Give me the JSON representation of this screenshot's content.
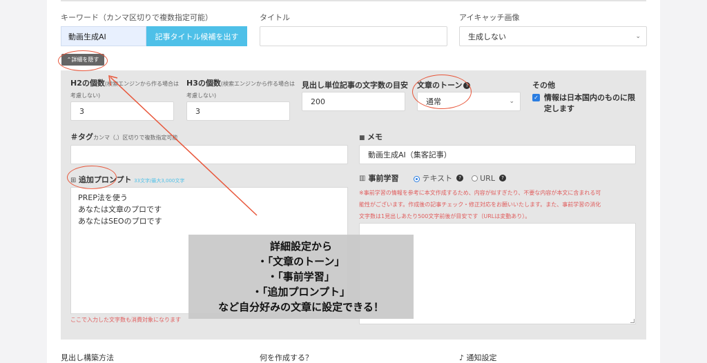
{
  "keyword": {
    "label": "キーワード（カンマ区切りで複数指定可能）",
    "value": "動画生成AI",
    "button": "記事タイトル候補を出す"
  },
  "title_field": {
    "label": "タイトル",
    "value": ""
  },
  "eyecatch": {
    "label": "アイキャッチ画像",
    "value": "生成しない"
  },
  "hide_button": "⌃詳細を隠す",
  "h2": {
    "label": "H2の個数",
    "note": "(検索エンジンから作る場合は考慮しない)",
    "value": "3"
  },
  "h3": {
    "label": "H3の個数",
    "note": "(検索エンジンから作る場合は考慮しない)",
    "value": "3"
  },
  "chars": {
    "label": "見出し単位記事の文字数の目安",
    "value": "200"
  },
  "tone": {
    "label": "文章のトーン",
    "value": "通常"
  },
  "other": {
    "label": "その他",
    "check_label": "情報は日本国内のものに限定します"
  },
  "tags": {
    "label": "＃タグ",
    "note": "カンマ（,）区切りで複数指定可能",
    "value": ""
  },
  "memo": {
    "label": "メモ",
    "value": "動画生成AI（集客記事）"
  },
  "prompt": {
    "label": "追加プロンプト",
    "count": "33文字/最大3,000文字",
    "lines": [
      "PREP法を使う",
      "あなたは文章のプロです",
      "あなたはSEOのプロです"
    ],
    "footer": "ここで入力した文字数も消費対象になります"
  },
  "pre_learning": {
    "label": "事前学習",
    "option_text": "テキスト",
    "option_url": "URL",
    "note_lines": [
      "※事前学習の情報を参考に本文作成するため、内容が似すぎたり、不要な内容が本文に含まれる可",
      "能性がございます。作成後の記事チェック・修正対応をお願いいたします。また、事前学習の消化",
      "文字数は1見出しあたり500文字前後が目安です（URLは変動あり）。"
    ]
  },
  "overlay_lines": [
    "詳細設定から",
    "・「文章のトーン」",
    "・「事前学習」",
    "・「追加プロンプト」",
    "など自分好みの文章に設定できる！"
  ],
  "bottom": {
    "heading_method": "見出し構築方法",
    "what_to_create": "何を作成する？",
    "notify": "通知設定"
  }
}
